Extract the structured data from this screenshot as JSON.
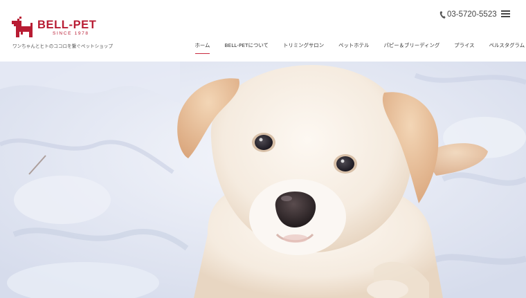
{
  "brand": {
    "name": "BELL-PET",
    "since": "SINCE 1978",
    "tagline": "ワンちゃんとヒトのココロを繋ぐペットショップ",
    "color": "#b81c33"
  },
  "contact": {
    "phone": "03-5720-5523",
    "icon": "phone-icon"
  },
  "menu": {
    "icon": "hamburger-menu-icon"
  },
  "nav": {
    "accent": "#c8283e",
    "items": [
      {
        "label": "ホーム",
        "active": true
      },
      {
        "label": "BELL-PETについて",
        "active": false
      },
      {
        "label": "トリミングサロン",
        "active": false
      },
      {
        "label": "ペットホテル",
        "active": false
      },
      {
        "label": "パピー＆ブリーディング",
        "active": false
      },
      {
        "label": "プライス",
        "active": false
      },
      {
        "label": "ペルスタグラム",
        "active": false
      }
    ]
  },
  "hero": {
    "subject": "white-puppy-in-snow",
    "snow_color": "#e4e9f4",
    "fur_color": "#f7ecdf",
    "ear_color": "#e4b48c"
  }
}
